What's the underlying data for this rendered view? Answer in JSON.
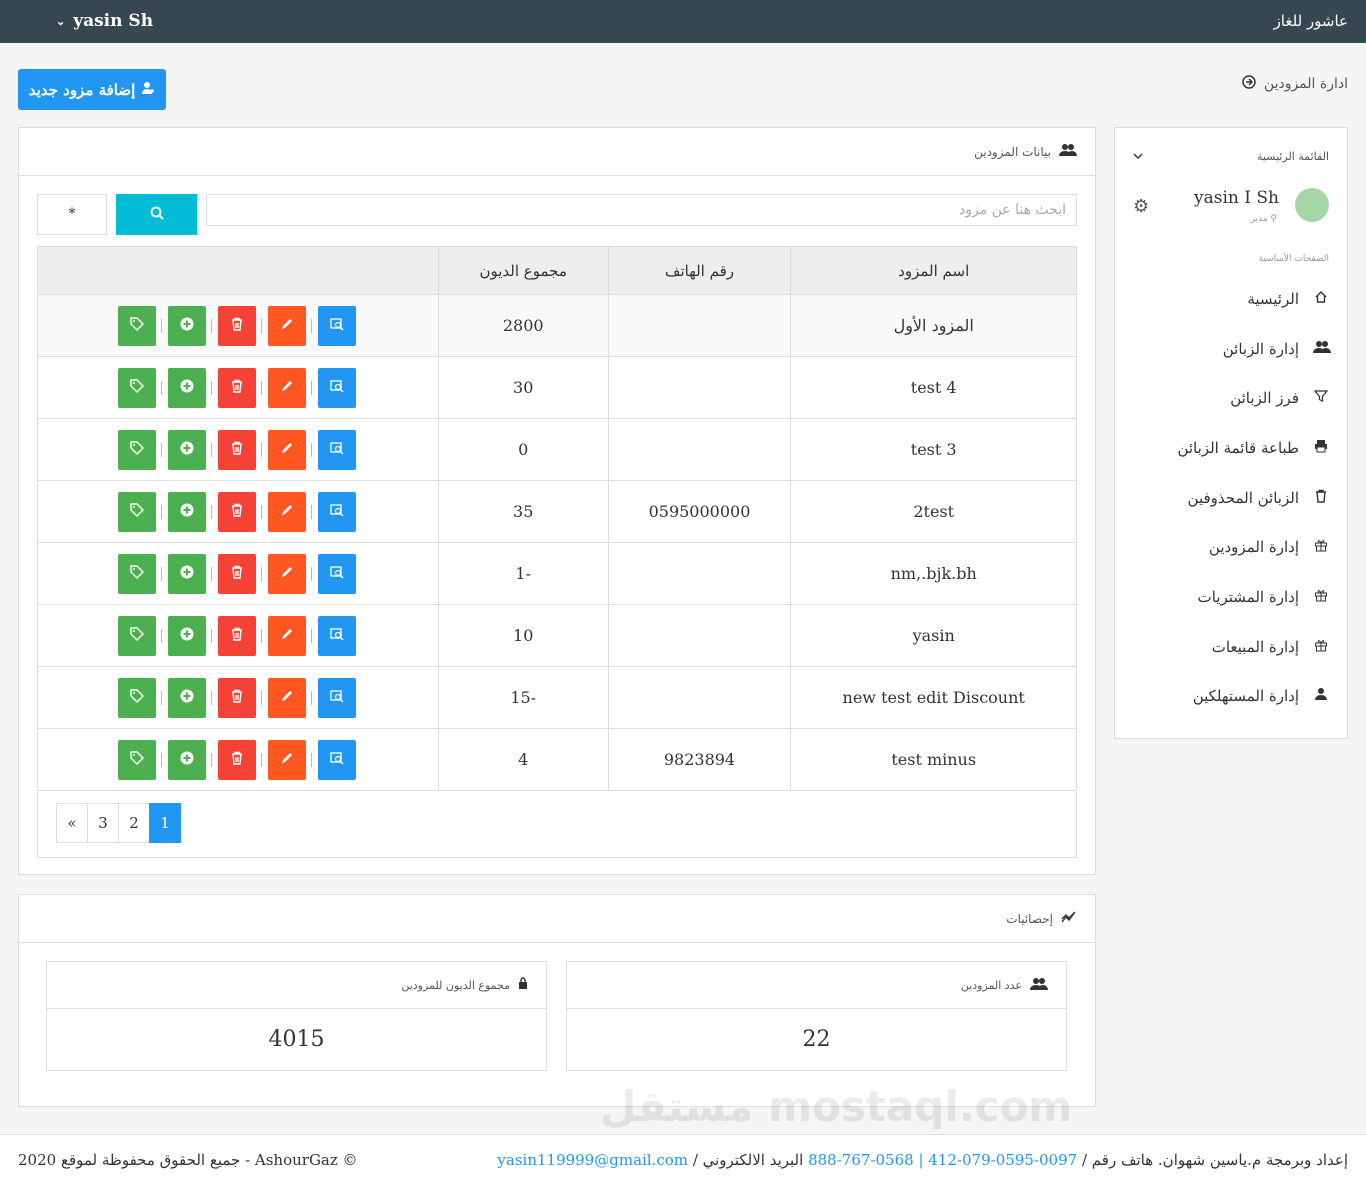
{
  "topbar": {
    "brand": "عاشور للغاز",
    "user": "yasin Sh",
    "caret": "⌄"
  },
  "page": {
    "title": "ادارة المزودين",
    "add_button": "إضافة مزود جديد"
  },
  "sidebar": {
    "menu_title": "القائمة الرئيسية",
    "user_name": "yasin I Sh",
    "user_role": "مدير",
    "section_label": "الصفحات الأساسية",
    "items": [
      {
        "label": "الرئيسية",
        "icon": "home-icon"
      },
      {
        "label": "إدارة الزبائن",
        "icon": "users-icon"
      },
      {
        "label": "فرز الزبائن",
        "icon": "filter-icon"
      },
      {
        "label": "طباعة قائمة الزبائن",
        "icon": "print-icon"
      },
      {
        "label": "الزبائن المحذوفين",
        "icon": "trash-icon"
      },
      {
        "label": "إدارة المزودين",
        "icon": "gift-icon"
      },
      {
        "label": "إدارة المشتريات",
        "icon": "gift-icon"
      },
      {
        "label": "إدارة المبيعات",
        "icon": "gift-icon"
      },
      {
        "label": "إدارة المستهلكين",
        "icon": "user-icon"
      }
    ]
  },
  "main": {
    "panel_title": "بيانات المزودين",
    "search_placeholder": "ابحث هنا عن مزود",
    "star_label": "*",
    "table": {
      "headers": [
        "اسم المزود",
        "رقم الهاتف",
        "مجموع الديون",
        ""
      ],
      "rows": [
        {
          "name": "المزود الأول",
          "phone": "",
          "debt": "2800"
        },
        {
          "name": "test 4",
          "phone": "",
          "debt": "30"
        },
        {
          "name": "test 3",
          "phone": "",
          "debt": "0"
        },
        {
          "name": "2test",
          "phone": "0595000000",
          "debt": "35"
        },
        {
          "name": "nm,.bjk.bh",
          "phone": "",
          "debt": "1-"
        },
        {
          "name": "yasin",
          "phone": "",
          "debt": "10"
        },
        {
          "name": "new test edit Discount",
          "phone": "",
          "debt": "15-"
        },
        {
          "name": "test minus",
          "phone": "9823894",
          "debt": "4"
        }
      ]
    },
    "pagination": [
      "«",
      "3",
      "2",
      "1"
    ]
  },
  "stats": {
    "title": "إحصائيات",
    "debt_total_label": "مجموع الديون للمزودين",
    "debt_total_value": "4015",
    "count_label": "عدد المزودين",
    "count_value": "22"
  },
  "footer": {
    "copyright": "جميع الحقوق محفوظة لموقع 2020 - AshourGaz ©",
    "credit": "إعداد وبرمجة م.ياسين شهوان. هاتف رقم /",
    "phones": "0097-0595-079-412 | 0568-767-888",
    "email_label": "البريد الالكتروني /",
    "email": "yasin119999@gmail.com"
  },
  "watermark": "مستقل mostaql.com"
}
